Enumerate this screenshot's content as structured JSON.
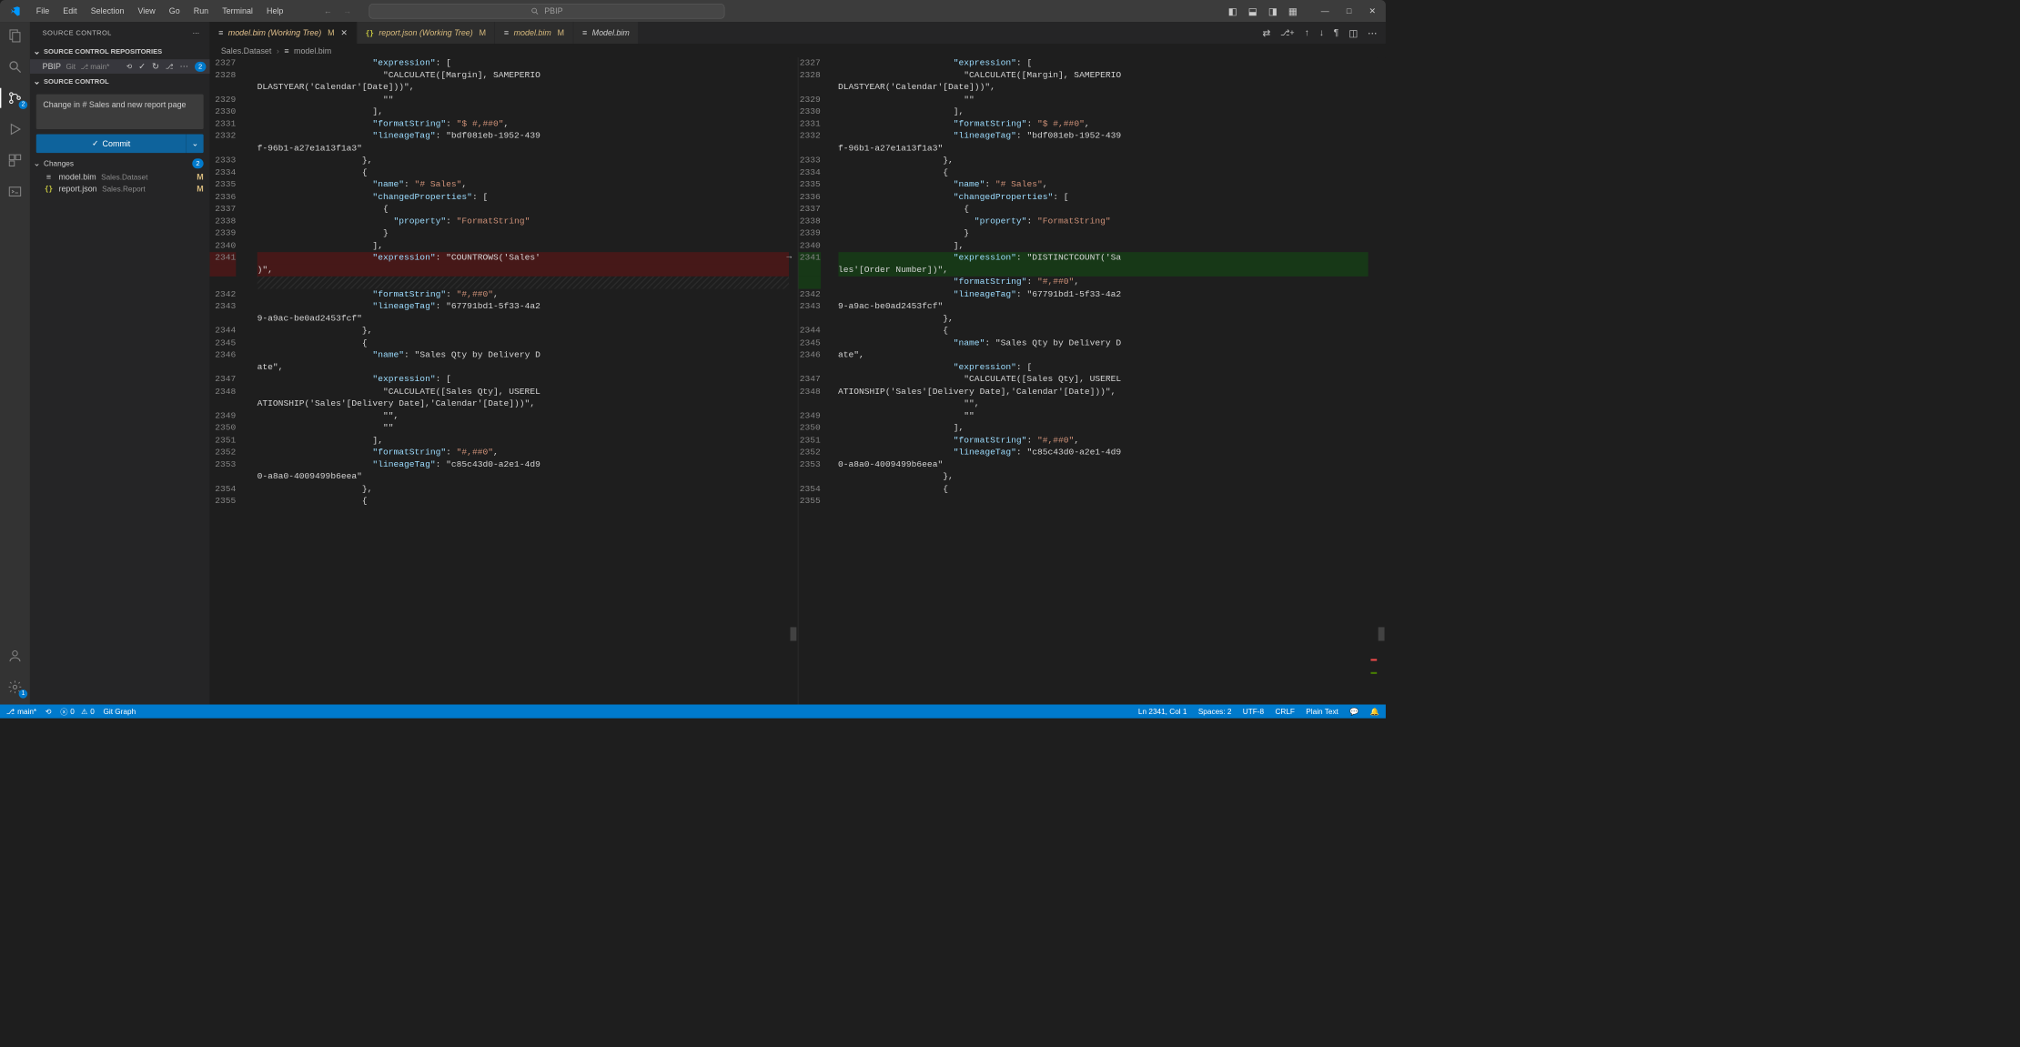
{
  "menu": [
    "File",
    "Edit",
    "Selection",
    "View",
    "Go",
    "Run",
    "Terminal",
    "Help"
  ],
  "search_placeholder": "PBIP",
  "sidebar": {
    "title": "SOURCE CONTROL",
    "repos_label": "SOURCE CONTROL REPOSITORIES",
    "repo_name": "PBIP",
    "repo_git": "Git",
    "branch": "main*",
    "repo_badge": "2",
    "scm_label": "SOURCE CONTROL",
    "commit_msg": "Change in # Sales and new report page",
    "commit_btn": "Commit",
    "changes_label": "Changes",
    "changes_badge": "2",
    "files": [
      {
        "icon": "db",
        "name": "model.bim",
        "path": "Sales.Dataset",
        "status": "M"
      },
      {
        "icon": "json",
        "name": "report.json",
        "path": "Sales.Report",
        "status": "M"
      }
    ]
  },
  "activity_badge": "2",
  "settings_badge": "1",
  "tabs": [
    {
      "icon": "db",
      "label": "model.bim (Working Tree)",
      "git": true,
      "mod": "M",
      "close": true,
      "active": true
    },
    {
      "icon": "json",
      "label": "report.json (Working Tree)",
      "git": true,
      "mod": "M",
      "close": false,
      "active": false
    },
    {
      "icon": "db",
      "label": "model.bim",
      "git": true,
      "mod": "M",
      "close": false,
      "active": false
    },
    {
      "icon": "db",
      "label": "Model.bim",
      "git": false,
      "mod": "",
      "close": false,
      "active": false
    }
  ],
  "breadcrumb": {
    "a": "Sales.Dataset",
    "b": "model.bim"
  },
  "status": {
    "branch": "main*",
    "sync": "",
    "errors": "0",
    "warnings": "0",
    "gitgraph": "Git Graph",
    "ln": "Ln 2341, Col 1",
    "spaces": "Spaces: 2",
    "encoding": "UTF-8",
    "eol": "CRLF",
    "lang": "Plain Text"
  },
  "lines_left": [
    {
      "n": "2327",
      "ind": 11,
      "t": "\"expression\": ["
    },
    {
      "n": "2328",
      "ind": 12,
      "t": "\"CALCULATE([Margin], SAMEPERIODLASTYEAR('Calendar'[Date]))\","
    },
    {
      "n": "2329",
      "ind": 12,
      "t": "\"\""
    },
    {
      "n": "2330",
      "ind": 11,
      "t": "],"
    },
    {
      "n": "2331",
      "ind": 11,
      "t": "\"formatString\": \"$ #,##0\","
    },
    {
      "n": "2332",
      "ind": 11,
      "t": "\"lineageTag\": \"bdf081eb-1952-439f-96b1-a27e1a13f1a3\""
    },
    {
      "n": "2333",
      "ind": 10,
      "t": "},"
    },
    {
      "n": "2334",
      "ind": 10,
      "t": "{"
    },
    {
      "n": "2335",
      "ind": 11,
      "t": "\"name\": \"# Sales\","
    },
    {
      "n": "2336",
      "ind": 11,
      "t": "\"changedProperties\": ["
    },
    {
      "n": "2337",
      "ind": 12,
      "t": "{"
    },
    {
      "n": "2338",
      "ind": 13,
      "t": "\"property\": \"FormatString\""
    },
    {
      "n": "2339",
      "ind": 12,
      "t": "}"
    },
    {
      "n": "2340",
      "ind": 11,
      "t": "],"
    },
    {
      "n": "2341",
      "ind": 11,
      "t": "\"expression\": \"COUNTROWS('Sales')\",",
      "removed": true,
      "pm": "−"
    },
    {
      "n": "",
      "ind": 0,
      "t": "",
      "hatch": true
    },
    {
      "n": "2342",
      "ind": 11,
      "t": "\"formatString\": \"#,##0\","
    },
    {
      "n": "2343",
      "ind": 11,
      "t": "\"lineageTag\": \"67791bd1-5f33-4a29-a9ac-be0ad2453fcf\""
    },
    {
      "n": "2344",
      "ind": 10,
      "t": "},"
    },
    {
      "n": "2345",
      "ind": 10,
      "t": "{"
    },
    {
      "n": "2346",
      "ind": 11,
      "t": "\"name\": \"Sales Qty by Delivery Date\","
    },
    {
      "n": "2347",
      "ind": 11,
      "t": "\"expression\": ["
    },
    {
      "n": "2348",
      "ind": 12,
      "t": "\"CALCULATE([Sales Qty], USERELATIONSHIP('Sales'[Delivery Date],'Calendar'[Date]))\","
    },
    {
      "n": "2349",
      "ind": 12,
      "t": "\"\","
    },
    {
      "n": "2350",
      "ind": 12,
      "t": "\"\""
    },
    {
      "n": "2351",
      "ind": 11,
      "t": "],"
    },
    {
      "n": "2352",
      "ind": 11,
      "t": "\"formatString\": \"#,##0\","
    },
    {
      "n": "2353",
      "ind": 11,
      "t": "\"lineageTag\": \"c85c43d0-a2e1-4d90-a8a0-4009499b6eea\""
    },
    {
      "n": "2354",
      "ind": 10,
      "t": "},"
    },
    {
      "n": "2355",
      "ind": 10,
      "t": "{"
    }
  ],
  "lines_right": [
    {
      "n": "2327",
      "ind": 11,
      "t": "\"expression\": ["
    },
    {
      "n": "2328",
      "ind": 12,
      "t": "\"CALCULATE([Margin], SAMEPERIODLASTYEAR('Calendar'[Date]))\","
    },
    {
      "n": "2329",
      "ind": 12,
      "t": "\"\""
    },
    {
      "n": "2330",
      "ind": 11,
      "t": "],"
    },
    {
      "n": "2331",
      "ind": 11,
      "t": "\"formatString\": \"$ #,##0\","
    },
    {
      "n": "2332",
      "ind": 11,
      "t": "\"lineageTag\": \"bdf081eb-1952-439f-96b1-a27e1a13f1a3\""
    },
    {
      "n": "2333",
      "ind": 10,
      "t": "},"
    },
    {
      "n": "2334",
      "ind": 10,
      "t": "{"
    },
    {
      "n": "2335",
      "ind": 11,
      "t": "\"name\": \"# Sales\","
    },
    {
      "n": "2336",
      "ind": 11,
      "t": "\"changedProperties\": ["
    },
    {
      "n": "2337",
      "ind": 12,
      "t": "{"
    },
    {
      "n": "2338",
      "ind": 13,
      "t": "\"property\": \"FormatString\""
    },
    {
      "n": "2339",
      "ind": 12,
      "t": "}"
    },
    {
      "n": "2340",
      "ind": 11,
      "t": "],"
    },
    {
      "n": "2341",
      "ind": 11,
      "t": "\"expression\": \"DISTINCTCOUNT('Sales'[Order Number])\",",
      "added": true,
      "pm": "+",
      "wrap2": true
    },
    {
      "n": "",
      "ind": 0,
      "t": "",
      "added": true,
      "pm": "+",
      "cont": true
    },
    {
      "n": "2342",
      "ind": 11,
      "t": "\"formatString\": \"#,##0\","
    },
    {
      "n": "2343",
      "ind": 11,
      "t": "\"lineageTag\": \"67791bd1-5f33-4a29-a9ac-be0ad2453fcf\""
    },
    {
      "n": "2344",
      "ind": 10,
      "t": "},"
    },
    {
      "n": "2345",
      "ind": 10,
      "t": "{"
    },
    {
      "n": "2346",
      "ind": 11,
      "t": "\"name\": \"Sales Qty by Delivery Date\","
    },
    {
      "n": "2347",
      "ind": 11,
      "t": "\"expression\": ["
    },
    {
      "n": "2348",
      "ind": 12,
      "t": "\"CALCULATE([Sales Qty], USERELATIONSHIP('Sales'[Delivery Date],'Calendar'[Date]))\","
    },
    {
      "n": "2349",
      "ind": 12,
      "t": "\"\","
    },
    {
      "n": "2350",
      "ind": 12,
      "t": "\"\""
    },
    {
      "n": "2351",
      "ind": 11,
      "t": "],"
    },
    {
      "n": "2352",
      "ind": 11,
      "t": "\"formatString\": \"#,##0\","
    },
    {
      "n": "2353",
      "ind": 11,
      "t": "\"lineageTag\": \"c85c43d0-a2e1-4d90-a8a0-4009499b6eea\""
    },
    {
      "n": "2354",
      "ind": 10,
      "t": "},"
    },
    {
      "n": "2355",
      "ind": 10,
      "t": "{"
    }
  ]
}
